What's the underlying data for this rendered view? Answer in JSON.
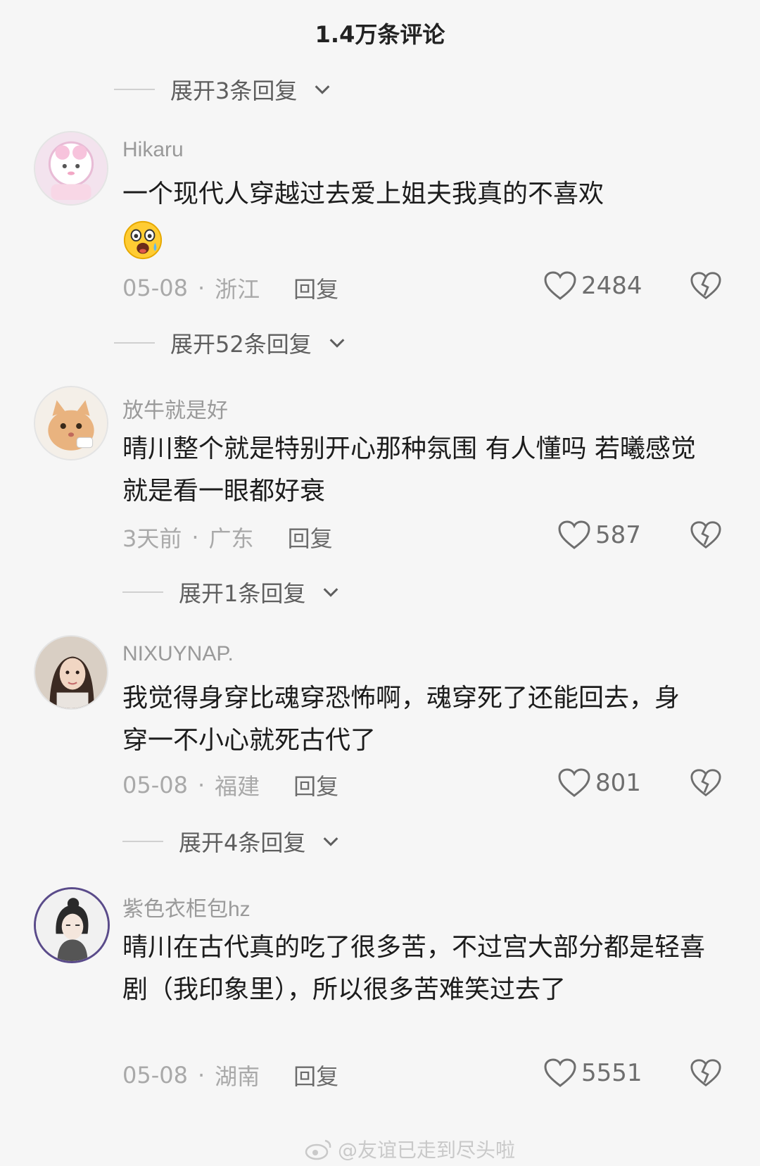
{
  "header": {
    "title": "1.4万条评论"
  },
  "expanders": [
    "展开3条回复",
    "展开52条回复",
    "展开1条回复",
    "展开4条回复"
  ],
  "comments": [
    {
      "username": "Hikaru",
      "text": "一个现代人穿越过去爱上姐夫我真的不喜欢",
      "date": "05-08",
      "location": "浙江",
      "reply": "回复",
      "likes": "2484"
    },
    {
      "username": "放牛就是好",
      "text": "晴川整个就是特别开心那种氛围 有人懂吗 若曦感觉就是看一眼都好衰",
      "date": "3天前",
      "location": "广东",
      "reply": "回复",
      "likes": "587"
    },
    {
      "username": "NIXUYNAP.",
      "text": "我觉得身穿比魂穿恐怖啊，魂穿死了还能回去，身穿一不小心就死古代了",
      "date": "05-08",
      "location": "福建",
      "reply": "回复",
      "likes": "801"
    },
    {
      "username": "紫色衣柜包hz",
      "text": "晴川在古代真的吃了很多苦，不过宫大部分都是轻喜剧（我印象里），所以很多苦难笑过去了",
      "date": "05-08",
      "location": "湖南",
      "reply": "回复",
      "likes": "5551"
    }
  ],
  "watermark": "@友谊已走到尽头啦",
  "meta_separator": "·",
  "icons": [
    "chevron-down-icon",
    "heart-icon",
    "broken-heart-icon",
    "scared-emoji-icon",
    "weibo-logo-icon"
  ]
}
